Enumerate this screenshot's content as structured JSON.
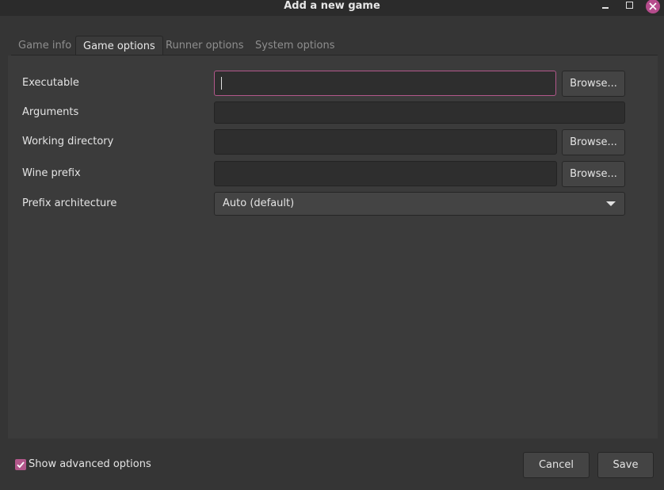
{
  "window": {
    "title": "Add a new game",
    "controls": [
      "minimize-icon",
      "maximize-icon",
      "close-icon"
    ],
    "accent_color": "#b2578b"
  },
  "tabs": [
    {
      "label": "Game info",
      "active": false
    },
    {
      "label": "Game options",
      "active": true
    },
    {
      "label": "Runner options",
      "active": false
    },
    {
      "label": "System options",
      "active": false
    }
  ],
  "form": {
    "executable": {
      "label": "Executable",
      "value": "",
      "browse": "Browse..."
    },
    "arguments": {
      "label": "Arguments",
      "value": ""
    },
    "working_directory": {
      "label": "Working directory",
      "value": "",
      "browse": "Browse..."
    },
    "wine_prefix": {
      "label": "Wine prefix",
      "value": "",
      "browse": "Browse..."
    },
    "prefix_architecture": {
      "label": "Prefix architecture",
      "selected": "Auto (default)"
    }
  },
  "footer": {
    "show_advanced": {
      "label": "Show advanced options",
      "checked": true
    },
    "cancel_label": "Cancel",
    "save_label": "Save"
  }
}
